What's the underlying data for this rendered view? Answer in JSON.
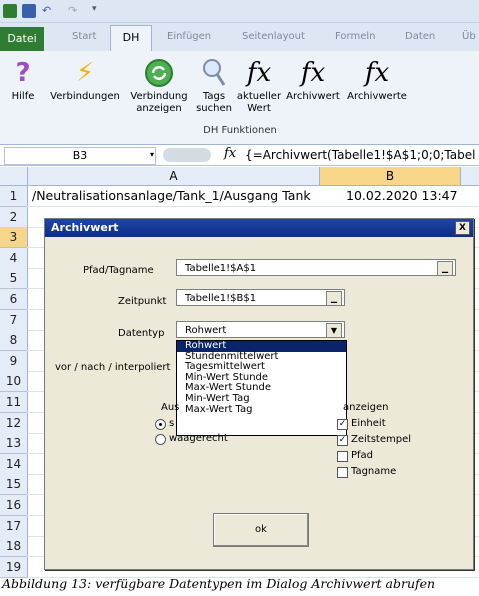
{
  "ribbon": {
    "tabs": [
      "Datei",
      "Start",
      "DH",
      "Einfügen",
      "Seitenlayout",
      "Formeln",
      "Daten",
      "Üb"
    ],
    "buttons": [
      {
        "label": "Hilfe",
        "icon": "help-icon"
      },
      {
        "label": "Verbindungen",
        "icon": "lightning-icon"
      },
      {
        "label": "Verbindung anzeigen",
        "icon": "refresh-icon"
      },
      {
        "label": "Tags suchen",
        "icon": "magnifier-icon"
      },
      {
        "label": "aktueller Wert",
        "icon": "fx-icon"
      },
      {
        "label": "Archivwert",
        "icon": "fx-icon"
      },
      {
        "label": "Archivwerte",
        "icon": "fx-icon"
      }
    ],
    "group_label": "DH Funktionen"
  },
  "formula_bar": {
    "name_box": "B3",
    "fx_label": "fx",
    "formula": "{=Archivwert(Tabelle1!$A$1;0;0;Tabel"
  },
  "grid": {
    "columns": [
      "A",
      "B"
    ],
    "rows": [
      "1",
      "2",
      "3",
      "4",
      "5",
      "6",
      "7",
      "8",
      "9",
      "10",
      "11",
      "12",
      "13",
      "14",
      "15",
      "16",
      "17",
      "18",
      "19"
    ],
    "selected_row": "3",
    "cell_a1": "/Neutralisationsanlage/Tank_1/Ausgang Tank",
    "cell_b1": "10.02.2020 13:47"
  },
  "dialog": {
    "title": "Archivwert",
    "close_label": "X",
    "pfad_label": "Pfad/Tagname",
    "pfad_value": "Tabelle1!$A$1",
    "zeitpunkt_label": "Zeitpunkt",
    "zeitpunkt_value": "Tabelle1!$B$1",
    "datentyp_label": "Datentyp",
    "datentyp_value": "Rohwert",
    "vni_label": "vor / nach / interpoliert",
    "ausgabe_partial": "Aus",
    "radio_partial": "s",
    "radio_waagerecht": "waagerecht",
    "anzeigen_partial": "anzeigen",
    "datentyp_options": [
      "Rohwert",
      "Stundenmittelwert",
      "Tagesmittelwert",
      "Min-Wert Stunde",
      "Max-Wert Stunde",
      "Min-Wert Tag",
      "Max-Wert Tag"
    ],
    "checkboxes": [
      {
        "label": "Einheit",
        "checked": true
      },
      {
        "label": "Zeitstempel",
        "checked": true
      },
      {
        "label": "Pfad",
        "checked": false
      },
      {
        "label": "Tagname",
        "checked": false
      }
    ],
    "ok_label": "ok"
  },
  "caption": "Abbildung 13: verfügbare Datentypen im Dialog Archivwert abrufen",
  "colors": {
    "accent_green": "#2e7d32",
    "selection_blue": "#0a246a",
    "title_blue": "#1f46a6",
    "dialog_bg": "#ece9d8"
  }
}
